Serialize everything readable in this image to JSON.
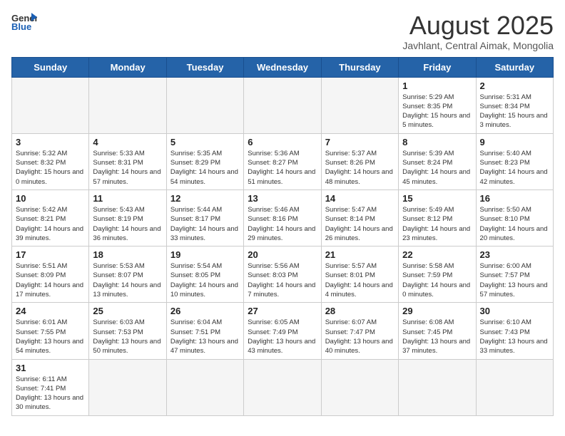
{
  "logo": {
    "general": "General",
    "blue": "Blue"
  },
  "calendar": {
    "title": "August 2025",
    "subtitle": "Javhlant, Central Aimak, Mongolia"
  },
  "headers": [
    "Sunday",
    "Monday",
    "Tuesday",
    "Wednesday",
    "Thursday",
    "Friday",
    "Saturday"
  ],
  "weeks": [
    [
      {
        "day": "",
        "text": ""
      },
      {
        "day": "",
        "text": ""
      },
      {
        "day": "",
        "text": ""
      },
      {
        "day": "",
        "text": ""
      },
      {
        "day": "",
        "text": ""
      },
      {
        "day": "1",
        "text": "Sunrise: 5:29 AM\nSunset: 8:35 PM\nDaylight: 15 hours\nand 5 minutes."
      },
      {
        "day": "2",
        "text": "Sunrise: 5:31 AM\nSunset: 8:34 PM\nDaylight: 15 hours\nand 3 minutes."
      }
    ],
    [
      {
        "day": "3",
        "text": "Sunrise: 5:32 AM\nSunset: 8:32 PM\nDaylight: 15 hours\nand 0 minutes."
      },
      {
        "day": "4",
        "text": "Sunrise: 5:33 AM\nSunset: 8:31 PM\nDaylight: 14 hours\nand 57 minutes."
      },
      {
        "day": "5",
        "text": "Sunrise: 5:35 AM\nSunset: 8:29 PM\nDaylight: 14 hours\nand 54 minutes."
      },
      {
        "day": "6",
        "text": "Sunrise: 5:36 AM\nSunset: 8:27 PM\nDaylight: 14 hours\nand 51 minutes."
      },
      {
        "day": "7",
        "text": "Sunrise: 5:37 AM\nSunset: 8:26 PM\nDaylight: 14 hours\nand 48 minutes."
      },
      {
        "day": "8",
        "text": "Sunrise: 5:39 AM\nSunset: 8:24 PM\nDaylight: 14 hours\nand 45 minutes."
      },
      {
        "day": "9",
        "text": "Sunrise: 5:40 AM\nSunset: 8:23 PM\nDaylight: 14 hours\nand 42 minutes."
      }
    ],
    [
      {
        "day": "10",
        "text": "Sunrise: 5:42 AM\nSunset: 8:21 PM\nDaylight: 14 hours\nand 39 minutes."
      },
      {
        "day": "11",
        "text": "Sunrise: 5:43 AM\nSunset: 8:19 PM\nDaylight: 14 hours\nand 36 minutes."
      },
      {
        "day": "12",
        "text": "Sunrise: 5:44 AM\nSunset: 8:17 PM\nDaylight: 14 hours\nand 33 minutes."
      },
      {
        "day": "13",
        "text": "Sunrise: 5:46 AM\nSunset: 8:16 PM\nDaylight: 14 hours\nand 29 minutes."
      },
      {
        "day": "14",
        "text": "Sunrise: 5:47 AM\nSunset: 8:14 PM\nDaylight: 14 hours\nand 26 minutes."
      },
      {
        "day": "15",
        "text": "Sunrise: 5:49 AM\nSunset: 8:12 PM\nDaylight: 14 hours\nand 23 minutes."
      },
      {
        "day": "16",
        "text": "Sunrise: 5:50 AM\nSunset: 8:10 PM\nDaylight: 14 hours\nand 20 minutes."
      }
    ],
    [
      {
        "day": "17",
        "text": "Sunrise: 5:51 AM\nSunset: 8:09 PM\nDaylight: 14 hours\nand 17 minutes."
      },
      {
        "day": "18",
        "text": "Sunrise: 5:53 AM\nSunset: 8:07 PM\nDaylight: 14 hours\nand 13 minutes."
      },
      {
        "day": "19",
        "text": "Sunrise: 5:54 AM\nSunset: 8:05 PM\nDaylight: 14 hours\nand 10 minutes."
      },
      {
        "day": "20",
        "text": "Sunrise: 5:56 AM\nSunset: 8:03 PM\nDaylight: 14 hours\nand 7 minutes."
      },
      {
        "day": "21",
        "text": "Sunrise: 5:57 AM\nSunset: 8:01 PM\nDaylight: 14 hours\nand 4 minutes."
      },
      {
        "day": "22",
        "text": "Sunrise: 5:58 AM\nSunset: 7:59 PM\nDaylight: 14 hours\nand 0 minutes."
      },
      {
        "day": "23",
        "text": "Sunrise: 6:00 AM\nSunset: 7:57 PM\nDaylight: 13 hours\nand 57 minutes."
      }
    ],
    [
      {
        "day": "24",
        "text": "Sunrise: 6:01 AM\nSunset: 7:55 PM\nDaylight: 13 hours\nand 54 minutes."
      },
      {
        "day": "25",
        "text": "Sunrise: 6:03 AM\nSunset: 7:53 PM\nDaylight: 13 hours\nand 50 minutes."
      },
      {
        "day": "26",
        "text": "Sunrise: 6:04 AM\nSunset: 7:51 PM\nDaylight: 13 hours\nand 47 minutes."
      },
      {
        "day": "27",
        "text": "Sunrise: 6:05 AM\nSunset: 7:49 PM\nDaylight: 13 hours\nand 43 minutes."
      },
      {
        "day": "28",
        "text": "Sunrise: 6:07 AM\nSunset: 7:47 PM\nDaylight: 13 hours\nand 40 minutes."
      },
      {
        "day": "29",
        "text": "Sunrise: 6:08 AM\nSunset: 7:45 PM\nDaylight: 13 hours\nand 37 minutes."
      },
      {
        "day": "30",
        "text": "Sunrise: 6:10 AM\nSunset: 7:43 PM\nDaylight: 13 hours\nand 33 minutes."
      }
    ],
    [
      {
        "day": "31",
        "text": "Sunrise: 6:11 AM\nSunset: 7:41 PM\nDaylight: 13 hours\nand 30 minutes."
      },
      {
        "day": "",
        "text": ""
      },
      {
        "day": "",
        "text": ""
      },
      {
        "day": "",
        "text": ""
      },
      {
        "day": "",
        "text": ""
      },
      {
        "day": "",
        "text": ""
      },
      {
        "day": "",
        "text": ""
      }
    ]
  ]
}
